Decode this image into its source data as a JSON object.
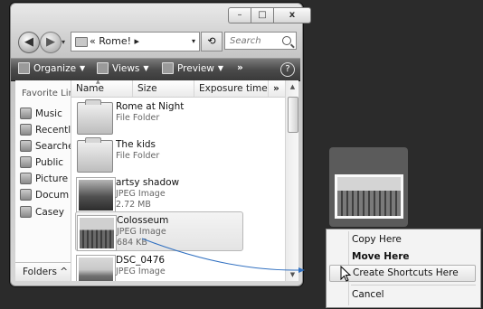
{
  "window": {
    "caption": {
      "minimize": "–",
      "maximize": "□",
      "close": "x"
    },
    "nav": {
      "back": "◀",
      "forward": "▶",
      "dropdown": "▾"
    },
    "address": {
      "path": "« Rome! ▸",
      "dropdown": "▾"
    },
    "refresh_glyph": "⟲",
    "search_placeholder": "Search",
    "toolbar": {
      "organize": "Organize",
      "views": "Views",
      "preview": "Preview",
      "more": "»",
      "help": "?"
    },
    "nav_pane": {
      "title": "Favorite Lin",
      "items": [
        {
          "label": "Music",
          "icon": "music-icon"
        },
        {
          "label": "Recentl",
          "icon": "recent-icon"
        },
        {
          "label": "Searche",
          "icon": "search-folder-icon"
        },
        {
          "label": "Public",
          "icon": "public-icon"
        },
        {
          "label": "Picture",
          "icon": "pictures-icon"
        },
        {
          "label": "Docum",
          "icon": "documents-icon"
        },
        {
          "label": "Casey",
          "icon": "user-icon"
        }
      ],
      "folders_button": "Folders ^"
    },
    "columns": [
      {
        "label": "Name"
      },
      {
        "label": "Size"
      },
      {
        "label": "Exposure time"
      },
      {
        "label": "»"
      }
    ],
    "files": [
      {
        "name": "Rome at Night",
        "type": "File Folder",
        "size": "",
        "kind": "folder",
        "selected": false
      },
      {
        "name": "The kids",
        "type": "File Folder",
        "size": "",
        "kind": "folder",
        "selected": false
      },
      {
        "name": "artsy shadow",
        "type": "JPEG Image",
        "size": "2.72 MB",
        "kind": "photo-shadow",
        "selected": false
      },
      {
        "name": "Colosseum",
        "type": "JPEG Image",
        "size": "684 KB",
        "kind": "photo-colosseum",
        "selected": true
      },
      {
        "name": "DSC_0476",
        "type": "JPEG Image",
        "size": "",
        "kind": "photo",
        "selected": false
      }
    ]
  },
  "context_menu": {
    "items": [
      {
        "label": "Copy Here",
        "bold": false,
        "hover": false
      },
      {
        "label": "Move Here",
        "bold": true,
        "hover": false
      },
      {
        "label": "Create Shortcuts Here",
        "bold": false,
        "hover": true
      },
      {
        "label": "Cancel",
        "bold": false,
        "hover": false
      }
    ]
  },
  "colors": {
    "background": "#2b2b2b",
    "toolbar": "#4b4b4b",
    "drag_line": "#2f6fc0"
  }
}
